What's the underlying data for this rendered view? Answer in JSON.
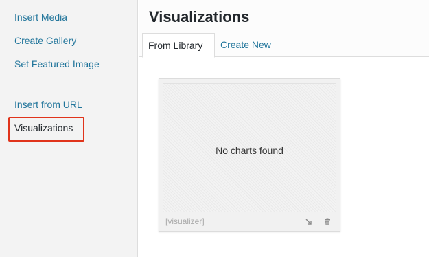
{
  "sidebar": {
    "items": [
      {
        "label": "Insert Media"
      },
      {
        "label": "Create Gallery"
      },
      {
        "label": "Set Featured Image"
      },
      {
        "label": "Insert from URL"
      },
      {
        "label": "Visualizations"
      }
    ],
    "active_highlight_color": "#e0341b"
  },
  "header": {
    "title": "Visualizations",
    "tabs": [
      {
        "label": "From Library"
      },
      {
        "label": "Create New"
      }
    ]
  },
  "library": {
    "empty_message": "No charts found",
    "shortcode": "[visualizer]",
    "actions": [
      {
        "icon": "resize-arrow-icon"
      },
      {
        "icon": "trash-icon"
      }
    ]
  },
  "colors": {
    "link": "#21759b",
    "text": "#23282d"
  }
}
